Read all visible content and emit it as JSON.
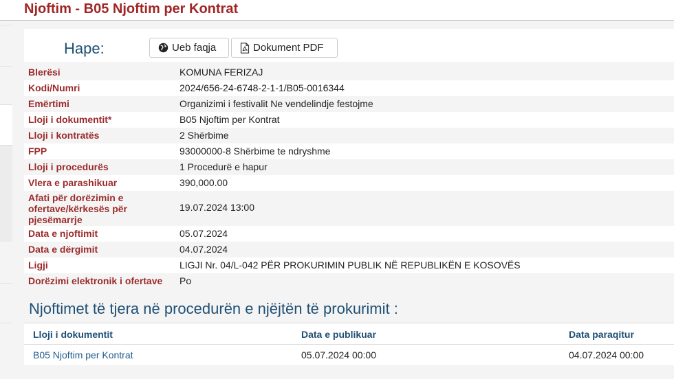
{
  "page": {
    "title": "Njoftim - B05 Njoftim per Kontrat"
  },
  "open_bar": {
    "label": "Hape:",
    "buttons": [
      {
        "label": "Ueb faqja",
        "icon": "globe-icon"
      },
      {
        "label": "Dokument PDF",
        "icon": "pdf-file-icon"
      }
    ]
  },
  "details": [
    {
      "label": "Blerësi",
      "value": "KOMUNA FERIZAJ"
    },
    {
      "label": "Kodi/Numri",
      "value": "2024/656-24-6748-2-1-1/B05-0016344"
    },
    {
      "label": "Emërtimi",
      "value": "Organizimi i festivalit Ne vendelindje festojme"
    },
    {
      "label": "Lloji i dokumentit*",
      "value": "B05 Njoftim per Kontrat"
    },
    {
      "label": "Lloji i kontratës",
      "value": "2 Shërbime"
    },
    {
      "label": "FPP",
      "value": "93000000-8 Shërbime te ndryshme"
    },
    {
      "label": "Lloji i procedurës",
      "value": "1 Procedurë e hapur"
    },
    {
      "label": "Vlera e parashikuar",
      "value": "390,000.00"
    },
    {
      "label": "Afati për dorëzimin e ofertave/kërkesës për pjesëmarrje",
      "value": "19.07.2024 13:00"
    },
    {
      "label": "Data e njoftimit",
      "value": "05.07.2024"
    },
    {
      "label": "Data e dërgimit",
      "value": "04.07.2024"
    },
    {
      "label": "Ligji",
      "value": "LIGJI Nr. 04/L-042 PËR PROKURIMIN PUBLIK NË REPUBLIKËN E KOSOVËS"
    },
    {
      "label": "Dorëzimi elektronik i ofertave",
      "value": "Po"
    }
  ],
  "other_notices": {
    "title": "Njoftimet të tjera në procedurën e njëjtën të prokurimit :",
    "columns": [
      "Lloji i dokumentit",
      "Data e publikuar",
      "Data paraqitur"
    ],
    "rows": [
      [
        "B05 Njoftim per Kontrat",
        "05.07.2024 00:00",
        "04.07.2024 00:00"
      ]
    ]
  },
  "colors": {
    "title_red": "#a02626",
    "label_red": "#9c2b2b",
    "heading_blue": "#1e4f74",
    "link_blue": "#1f5b8c"
  }
}
